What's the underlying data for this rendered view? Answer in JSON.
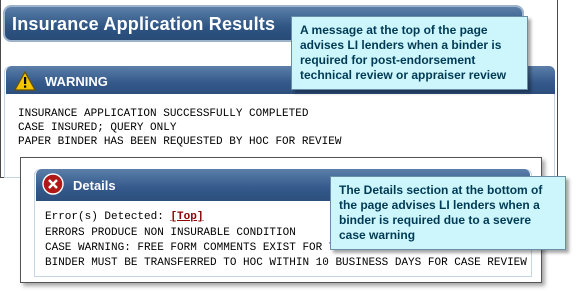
{
  "page": {
    "title": "Insurance Application Results"
  },
  "warning": {
    "title": "WARNING",
    "lines": [
      "INSURANCE APPLICATION SUCCESSFULLY COMPLETED",
      "CASE INSURED; QUERY ONLY",
      "PAPER BINDER HAS BEEN REQUESTED BY HOC FOR REVIEW"
    ]
  },
  "details": {
    "title": "Details",
    "errors_label": "Error(s) Detected:",
    "top_link": "[Top]",
    "lines": [
      "ERRORS PRODUCE NON INSURABLE CONDITION",
      "CASE WARNING: FREE FORM COMMENTS EXIST FOR THIS CASE",
      "BINDER MUST BE TRANSFERRED TO HOC WITHIN 10 BUSINESS DAYS FOR CASE REVIEW"
    ]
  },
  "callouts": {
    "top": "A message at the top of the page advises LI lenders when a binder is required for post-endorsement technical review or appraiser review",
    "bottom": "The Details section at the bottom of the page advises LI lenders when a binder is required due to a severe case warning"
  },
  "colors": {
    "header_blue": "#34598a",
    "callout_bg": "#ccf6fb",
    "link_red": "#8b0000"
  },
  "icons": {
    "warning": "warning-triangle-icon",
    "details": "error-x-icon"
  }
}
